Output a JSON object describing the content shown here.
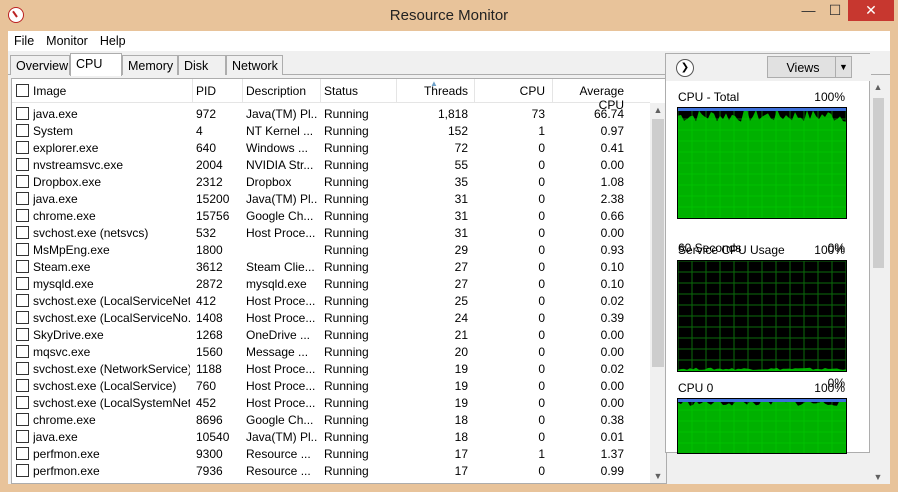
{
  "window": {
    "title": "Resource Monitor",
    "min_glyph": "—",
    "max_glyph": "☐",
    "close_glyph": "✕"
  },
  "menu": [
    "File",
    "Monitor",
    "Help"
  ],
  "tabs": [
    "Overview",
    "CPU",
    "Memory",
    "Disk",
    "Network"
  ],
  "active_tab": "CPU",
  "table": {
    "headers": {
      "image": "Image",
      "pid": "PID",
      "description": "Description",
      "status": "Status",
      "threads": "Threads",
      "cpu": "CPU",
      "avg_cpu": "Average CPU"
    },
    "sorted_by": "Threads",
    "rows": [
      [
        "java.exe",
        "972",
        "Java(TM) Pl...",
        "Running",
        "1,818",
        "73",
        "66.74"
      ],
      [
        "System",
        "4",
        "NT Kernel ...",
        "Running",
        "152",
        "1",
        "0.97"
      ],
      [
        "explorer.exe",
        "640",
        "Windows ...",
        "Running",
        "72",
        "0",
        "0.41"
      ],
      [
        "nvstreamsvc.exe",
        "2004",
        "NVIDIA Str...",
        "Running",
        "55",
        "0",
        "0.00"
      ],
      [
        "Dropbox.exe",
        "2312",
        "Dropbox",
        "Running",
        "35",
        "0",
        "1.08"
      ],
      [
        "java.exe",
        "15200",
        "Java(TM) Pl...",
        "Running",
        "31",
        "0",
        "2.38"
      ],
      [
        "chrome.exe",
        "15756",
        "Google Ch...",
        "Running",
        "31",
        "0",
        "0.66"
      ],
      [
        "svchost.exe (netsvcs)",
        "532",
        "Host Proce...",
        "Running",
        "31",
        "0",
        "0.00"
      ],
      [
        "MsMpEng.exe",
        "1800",
        "",
        "Running",
        "29",
        "0",
        "0.93"
      ],
      [
        "Steam.exe",
        "3612",
        "Steam Clie...",
        "Running",
        "27",
        "0",
        "0.10"
      ],
      [
        "mysqld.exe",
        "2872",
        "mysqld.exe",
        "Running",
        "27",
        "0",
        "0.10"
      ],
      [
        "svchost.exe (LocalServiceNet...",
        "412",
        "Host Proce...",
        "Running",
        "25",
        "0",
        "0.02"
      ],
      [
        "svchost.exe (LocalServiceNo...",
        "1408",
        "Host Proce...",
        "Running",
        "24",
        "0",
        "0.39"
      ],
      [
        "SkyDrive.exe",
        "1268",
        "OneDrive ...",
        "Running",
        "21",
        "0",
        "0.00"
      ],
      [
        "mqsvc.exe",
        "1560",
        "Message ...",
        "Running",
        "20",
        "0",
        "0.00"
      ],
      [
        "svchost.exe (NetworkService)",
        "1188",
        "Host Proce...",
        "Running",
        "19",
        "0",
        "0.02"
      ],
      [
        "svchost.exe (LocalService)",
        "760",
        "Host Proce...",
        "Running",
        "19",
        "0",
        "0.00"
      ],
      [
        "svchost.exe (LocalSystemNet...",
        "452",
        "Host Proce...",
        "Running",
        "19",
        "0",
        "0.00"
      ],
      [
        "chrome.exe",
        "8696",
        "Google Ch...",
        "Running",
        "18",
        "0",
        "0.38"
      ],
      [
        "java.exe",
        "10540",
        "Java(TM) Pl...",
        "Running",
        "18",
        "0",
        "0.01"
      ],
      [
        "perfmon.exe",
        "9300",
        "Resource ...",
        "Running",
        "17",
        "1",
        "1.37"
      ],
      [
        "perfmon.exe",
        "7936",
        "Resource ...",
        "Running",
        "17",
        "0",
        "0.99"
      ]
    ]
  },
  "graph_panel": {
    "views_label": "Views",
    "graphs": [
      {
        "label": "CPU - Total",
        "max": "100%",
        "min": "0%",
        "footer": "60 Seconds",
        "level": 0.93,
        "color": "#00d000"
      },
      {
        "label": "Service CPU Usage",
        "max": "100%",
        "min": "0%",
        "footer": "",
        "level": 0.02,
        "color": "#00d000"
      },
      {
        "label": "CPU 0",
        "max": "100%",
        "min": "",
        "footer": "",
        "level": 0.93,
        "color": "#00d000"
      }
    ]
  },
  "colors": {
    "frame": "#e8c39a",
    "close_button": "#c7372f",
    "graph_fill": "#00d000",
    "graph_grid": "#0b6b0b"
  }
}
